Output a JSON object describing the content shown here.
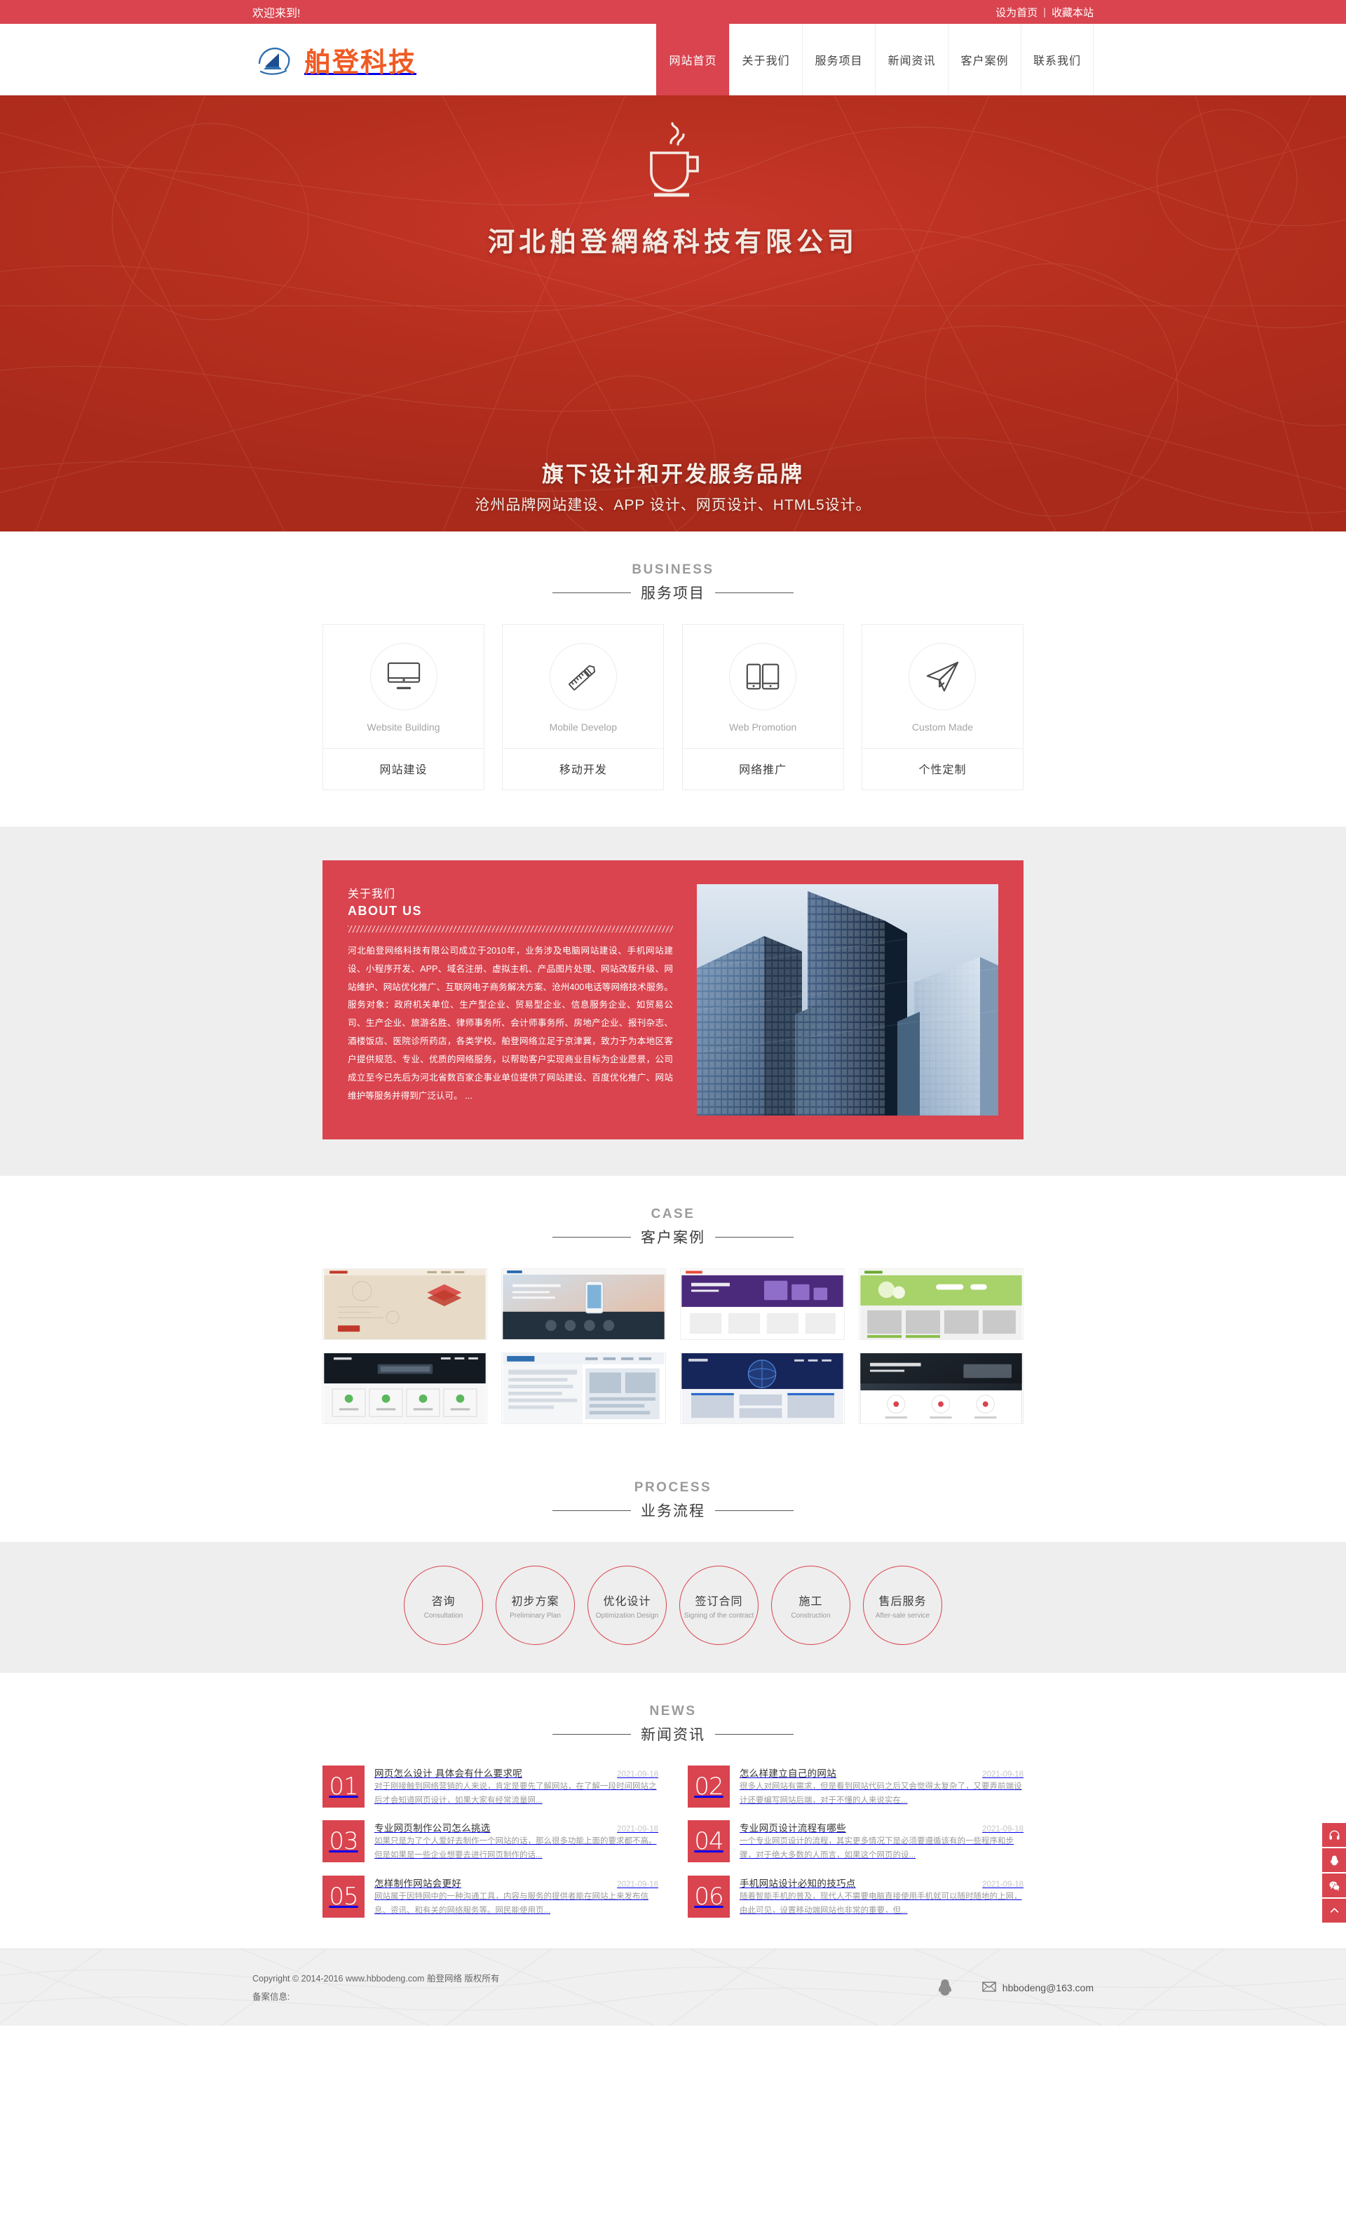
{
  "topbar": {
    "welcome": "欢迎来到!",
    "set_home": "设为首页",
    "separator": "|",
    "bookmark": "收藏本站"
  },
  "header": {
    "logo_text": "舶登科技",
    "logo_icon": "ship-logo-icon",
    "nav": [
      {
        "label": "网站首页",
        "active": true
      },
      {
        "label": "关于我们",
        "active": false
      },
      {
        "label": "服务项目",
        "active": false
      },
      {
        "label": "新闻资讯",
        "active": false
      },
      {
        "label": "客户案例",
        "active": false
      },
      {
        "label": "联系我们",
        "active": false
      }
    ]
  },
  "hero": {
    "icon": "coffee-cup-icon",
    "title": "河北舶登網絡科技有限公司",
    "subtitle_main": "旗下设计和开发服务品牌",
    "subtitle_sub": "沧州品牌网站建设、APP 设计、网页设计、HTML5设计。",
    "bg_color": "#b8301f"
  },
  "business": {
    "title_en": "BUSINESS",
    "title_cn": "服务项目",
    "cards": [
      {
        "icon": "monitor-icon",
        "en": "Website Building",
        "cn": "网站建设"
      },
      {
        "icon": "ruler-pencil-icon",
        "en": "Mobile Develop",
        "cn": "移动开发"
      },
      {
        "icon": "devices-icon",
        "en": "Web Promotion",
        "cn": "网络推广"
      },
      {
        "icon": "paper-plane-icon",
        "en": "Custom Made",
        "cn": "个性定制"
      }
    ]
  },
  "about": {
    "title_cn": "关于我们",
    "title_en": "ABOUT US",
    "body": "河北舶登网络科技有限公司成立于2010年，业务涉及电脑网站建设、手机网站建设、小程序开发、APP、域名注册、虚拟主机、产品图片处理、网站改版升级、网站维护、网站优化推广、互联网电子商务解决方案、沧州400电话等网络技术服务。服务对象：政府机关单位、生产型企业、贸易型企业、信息服务企业、如贸易公司、生产企业、旅游名胜、律师事务所、会计师事务所、房地产企业、报刊杂志、酒楼饭店、医院诊所药店，各类学校。舶登网络立足于京津冀，致力于为本地区客户提供规范、专业、优质的网络服务，以帮助客户实现商业目标为企业愿景，公司成立至今已先后为河北省数百家企事业单位提供了网站建设、百度优化推广、网站维护等服务并得到广泛认可。 ...",
    "image_alt": "city-skyscrapers-photo",
    "accent_color": "#d9444f"
  },
  "case": {
    "title_en": "CASE",
    "title_cn": "客户案例",
    "items": [
      {
        "name": "case-thumbnail-1",
        "theme": "#e2d6c3"
      },
      {
        "name": "case-thumbnail-2",
        "theme": "#2c3440"
      },
      {
        "name": "case-thumbnail-3",
        "theme": "#4a2a78"
      },
      {
        "name": "case-thumbnail-4",
        "theme": "#8fc24a"
      },
      {
        "name": "case-thumbnail-5",
        "theme": "#12161c"
      },
      {
        "name": "case-thumbnail-6",
        "theme": "#f2f2f2"
      },
      {
        "name": "case-thumbnail-7",
        "theme": "#1b2a57"
      },
      {
        "name": "case-thumbnail-8",
        "theme": "#1a1f26"
      }
    ]
  },
  "process": {
    "title_en": "PROCESS",
    "title_cn": "业务流程",
    "steps": [
      {
        "cn": "咨询",
        "en": "Consultation"
      },
      {
        "cn": "初步方案",
        "en": "Preliminary Plan"
      },
      {
        "cn": "优化设计",
        "en": "Optimization Design"
      },
      {
        "cn": "签订合同",
        "en": "Signing of the contract"
      },
      {
        "cn": "施工",
        "en": "Construction"
      },
      {
        "cn": "售后服务",
        "en": "After-sale service"
      }
    ]
  },
  "news": {
    "title_en": "NEWS",
    "title_cn": "新闻资讯",
    "items": [
      {
        "num": "01",
        "title": "网页怎么设计 具体会有什么要求呢",
        "date": "2021-09-18",
        "desc": "对于刚接触到网络营销的人来说，肯定是要先了解网站，在了解一段时间网站之后才会知道网页设计，如果大家有经常流量网..."
      },
      {
        "num": "02",
        "title": "怎么样建立自己的网站",
        "date": "2021-09-18",
        "desc": "很多人对网站有需求，但是看到网站代码之后又会觉得太复杂了，又要弄前端设计还要编写网站后端，对于不懂的人来说实在..."
      },
      {
        "num": "03",
        "title": "专业网页制作公司怎么挑选",
        "date": "2021-09-18",
        "desc": "如果只是为了个人爱好去制作一个网站的话，那么很多功能上面的要求都不高。但是如果是一些企业想要去进行网页制作的话..."
      },
      {
        "num": "04",
        "title": "专业网页设计流程有哪些",
        "date": "2021-09-18",
        "desc": "一个专业网页设计的流程，其实更多情况下是必须要遵循该有的一些程序和步骤，对于绝大多数的人而言，如果这个网页的设..."
      },
      {
        "num": "05",
        "title": "怎样制作网站会更好",
        "date": "2021-09-18",
        "desc": "网站属于因特网中的一种沟通工具，内容与服务的提供者能在网站上来发布信息、资讯、和有关的网络服务等。网民能使用页..."
      },
      {
        "num": "06",
        "title": "手机网站设计必知的技巧点",
        "date": "2021-09-18",
        "desc": "随着智能手机的普及，现代人不需要电脑直接使用手机就可以随时随地的上网，由此可见，设置移动端网站也非常的重要，但..."
      }
    ]
  },
  "footer": {
    "copyright": "Copyright © 2014-2016 www.hbbodeng.com 舶登网络 版权所有",
    "icp": "备案信息:",
    "qq_icon": "qq-penguin-icon",
    "mail_icon": "envelope-icon",
    "email": "hbbodeng@163.com"
  },
  "sidebar_float": {
    "buttons": [
      {
        "icon": "headset-service-icon",
        "name": "online-service"
      },
      {
        "icon": "qq-chat-icon",
        "name": "qq-chat"
      },
      {
        "icon": "wechat-qr-icon",
        "name": "wechat-qr"
      },
      {
        "icon": "arrow-up-icon",
        "name": "back-to-top"
      }
    ],
    "color": "#d9444f"
  }
}
